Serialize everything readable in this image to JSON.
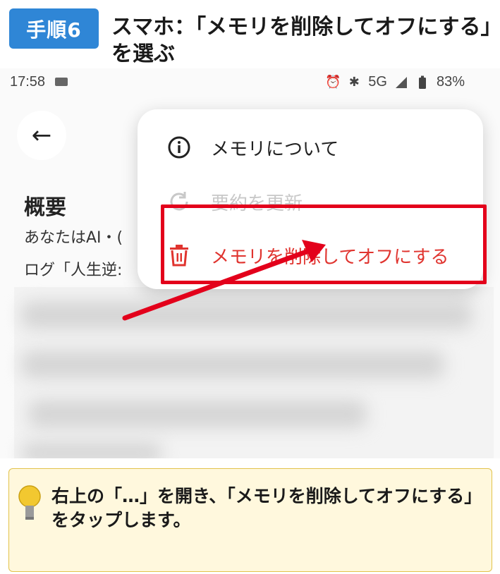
{
  "header": {
    "step_label": "手順6",
    "title": "スマホ：「メモリを削除してオフにする」を選ぶ"
  },
  "status_bar": {
    "time": "17:58",
    "network": "5G",
    "battery": "83%"
  },
  "screen": {
    "overview_title": "概要",
    "overview_line1": "あなたはAI・(",
    "overview_line2": "ログ「人生逆:"
  },
  "menu": {
    "items": [
      {
        "label": "メモリについて",
        "icon": "info-icon"
      },
      {
        "label": "要約を更新",
        "icon": "refresh-icon"
      },
      {
        "label": "メモリを削除してオフにする",
        "icon": "trash-icon"
      }
    ]
  },
  "colors": {
    "badge": "#2f86d6",
    "highlight": "#e3001b",
    "danger_text": "#e0342f",
    "tip_bg": "#fff8dd"
  },
  "tip": {
    "text": "右上の「…」を開き、「メモリを削除してオフにする」をタップします。",
    "icon": "lightbulb-icon"
  }
}
